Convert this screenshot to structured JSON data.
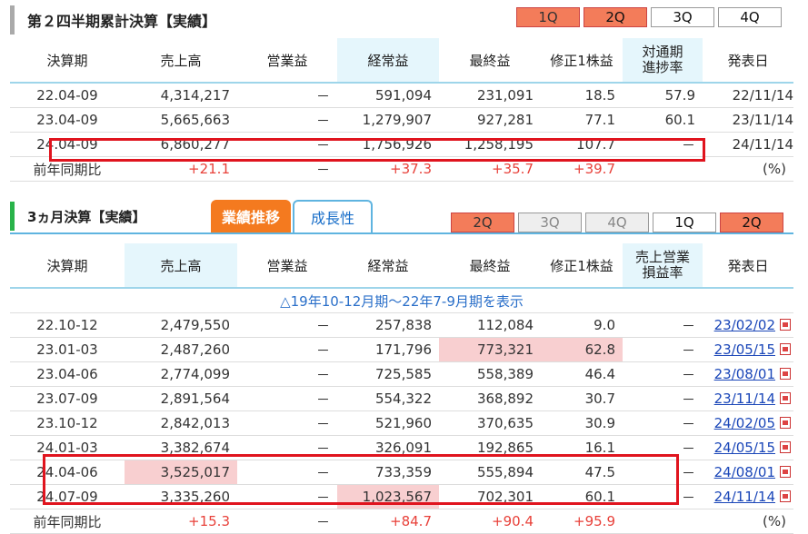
{
  "section1": {
    "title": "第２四半期累計決算【実績】",
    "qtabs": [
      "1Q",
      "2Q",
      "3Q",
      "4Q"
    ],
    "headers": [
      "決算期",
      "売上高",
      "営業益",
      "経常益",
      "最終益",
      "修正1株益",
      "対通期\n進捗率",
      "発表日"
    ],
    "rows": [
      [
        "22.04-09",
        "4,314,217",
        "－",
        "591,094",
        "231,091",
        "18.5",
        "57.9",
        "22/11/14"
      ],
      [
        "23.04-09",
        "5,665,663",
        "－",
        "1,279,907",
        "927,281",
        "77.1",
        "60.1",
        "23/11/14"
      ],
      [
        "24.04-09",
        "6,860,277",
        "－",
        "1,756,926",
        "1,258,195",
        "107.7",
        "－",
        "24/11/14"
      ]
    ],
    "yoy": [
      "前年同期比",
      "+21.1",
      "－",
      "+37.3",
      "+35.7",
      "+39.7",
      "",
      "(%)"
    ]
  },
  "section2": {
    "title": "3ヵ月決算【実績】",
    "tab_active": "業績推移",
    "tab_inactive": "成長性",
    "qtabs": [
      "2Q",
      "3Q",
      "4Q",
      "1Q",
      "2Q"
    ],
    "headers": [
      "決算期",
      "売上高",
      "営業益",
      "経常益",
      "最終益",
      "修正1株益",
      "売上営業\n損益率",
      "発表日"
    ],
    "expand": "△19年10-12月期～22年7-9月期を表示",
    "rows": [
      [
        "22.10-12",
        "2,479,550",
        "－",
        "257,838",
        "112,084",
        "9.0",
        "－",
        "23/02/02"
      ],
      [
        "23.01-03",
        "2,487,260",
        "－",
        "171,796",
        "773,321",
        "62.8",
        "－",
        "23/05/15"
      ],
      [
        "23.04-06",
        "2,774,099",
        "－",
        "725,585",
        "558,389",
        "46.4",
        "－",
        "23/08/01"
      ],
      [
        "23.07-09",
        "2,891,564",
        "－",
        "554,322",
        "368,892",
        "30.7",
        "－",
        "23/11/14"
      ],
      [
        "23.10-12",
        "2,842,013",
        "－",
        "521,960",
        "370,635",
        "30.9",
        "－",
        "24/02/05"
      ],
      [
        "24.01-03",
        "3,382,674",
        "－",
        "326,091",
        "192,865",
        "16.1",
        "－",
        "24/05/15"
      ],
      [
        "24.04-06",
        "3,525,017",
        "－",
        "733,359",
        "555,894",
        "47.5",
        "－",
        "24/08/01"
      ],
      [
        "24.07-09",
        "3,335,260",
        "－",
        "1,023,567",
        "702,301",
        "60.1",
        "－",
        "24/11/14"
      ]
    ],
    "yoy": [
      "前年同期比",
      "+15.3",
      "－",
      "+84.7",
      "+90.4",
      "+95.9",
      "",
      "(%)"
    ]
  },
  "colors": {
    "accent_red": "#e8413a",
    "highlight_pink": "#f8cfd0",
    "header_blue": "#e5f6fc",
    "box_red": "#e0141e",
    "orange_tab": "#f37c5a",
    "green_bar": "#29b34a"
  }
}
